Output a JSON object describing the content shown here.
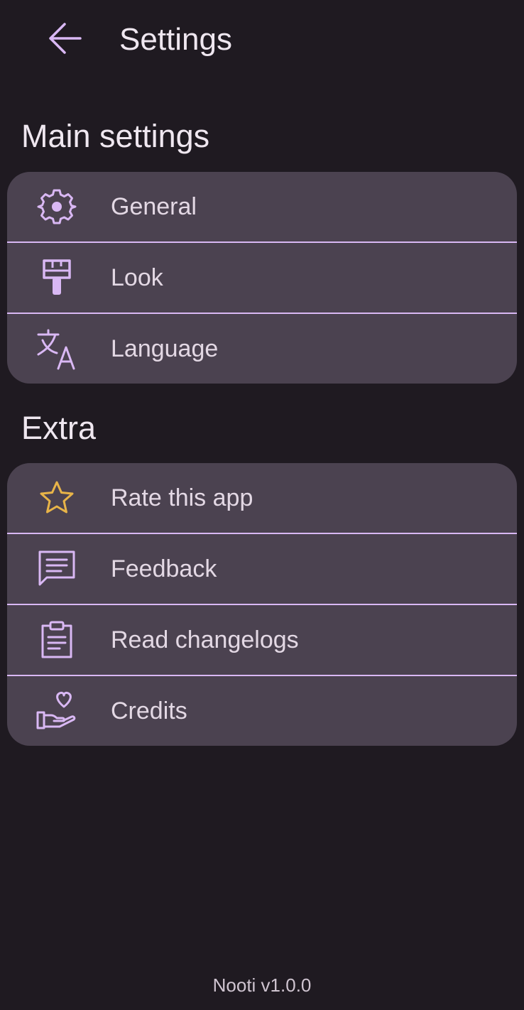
{
  "header": {
    "title": "Settings",
    "back_icon": "arrow-left-icon",
    "accent": "#d9b8f4"
  },
  "main_settings": {
    "title": "Main settings",
    "items": [
      {
        "label": "General",
        "icon": "gear-icon"
      },
      {
        "label": "Look",
        "icon": "paint-brush-icon"
      },
      {
        "label": "Language",
        "icon": "translate-icon"
      }
    ]
  },
  "extra": {
    "title": "Extra",
    "items": [
      {
        "label": "Rate this app",
        "icon": "star-icon",
        "icon_color": "#e8b448"
      },
      {
        "label": "Feedback",
        "icon": "chat-bubble-icon"
      },
      {
        "label": "Read changelogs",
        "icon": "clipboard-list-icon"
      },
      {
        "label": "Credits",
        "icon": "hand-heart-icon"
      }
    ]
  },
  "footer": {
    "version": "Nooti v1.0.0"
  }
}
